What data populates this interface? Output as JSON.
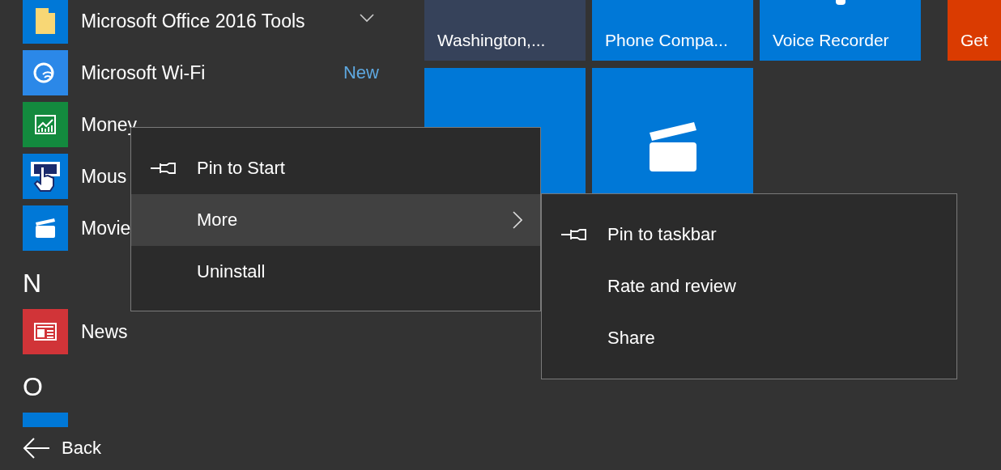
{
  "app_list": [
    {
      "kind": "app",
      "label": "Microsoft Office 2016 Tools",
      "color": "#0078d7",
      "expandable": true
    },
    {
      "kind": "app",
      "label": "Microsoft Wi-Fi",
      "color": "#2b88e8",
      "badge": "New"
    },
    {
      "kind": "app",
      "label": "Money",
      "color": "#138a3e"
    },
    {
      "kind": "app",
      "label": "Mous",
      "color": "#0078d7"
    },
    {
      "kind": "app",
      "label": "Movie",
      "color": "#0078d7"
    },
    {
      "kind": "letter",
      "label": "N"
    },
    {
      "kind": "app",
      "label": "News",
      "color": "#d13438"
    },
    {
      "kind": "letter",
      "label": "O"
    },
    {
      "kind": "app",
      "color": "#0078d7"
    }
  ],
  "back": {
    "label": "Back"
  },
  "tile_rows": [
    [
      {
        "label": "Washington,...",
        "color": "#36425a"
      },
      {
        "label": "Phone Compa...",
        "color": "#0078d7"
      },
      {
        "label": "Voice Recorder",
        "color": "#0078d7"
      },
      {
        "label": "Get",
        "color": "#da3b01"
      }
    ],
    [
      {
        "color": "#0078d7"
      },
      {
        "color": "#0078d7"
      }
    ]
  ],
  "context_menu": {
    "items": [
      {
        "label": "Pin to Start",
        "selected": false,
        "submenu": false
      },
      {
        "label": "More",
        "selected": true,
        "submenu": true
      },
      {
        "label": "Uninstall",
        "selected": false,
        "submenu": false
      }
    ]
  },
  "submenu": {
    "items": [
      {
        "label": "Pin to taskbar",
        "selected": false
      },
      {
        "label": "Rate and review",
        "selected": false
      },
      {
        "label": "Share",
        "selected": false
      }
    ]
  }
}
